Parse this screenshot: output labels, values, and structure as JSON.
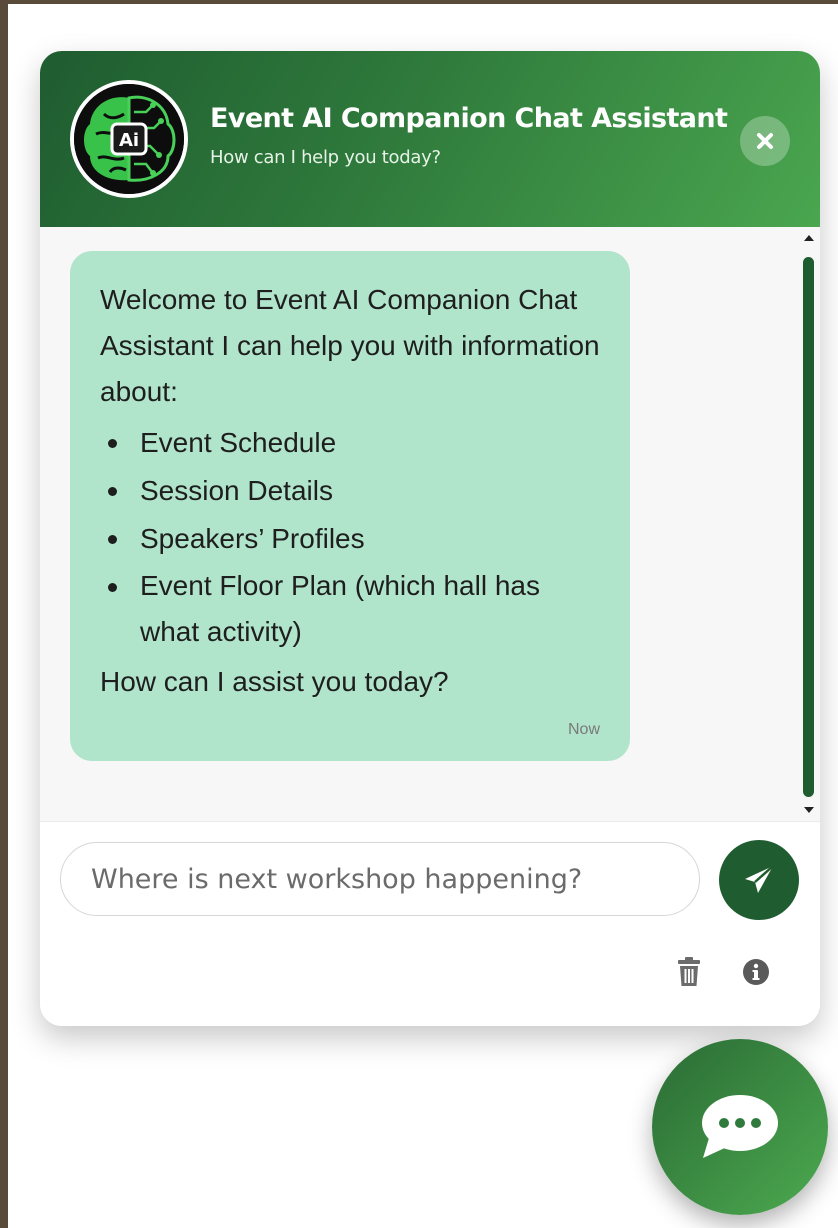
{
  "header": {
    "title": "Event AI Companion Chat Assistant",
    "subtitle": "How can I help you today?",
    "avatar_text": "Ai",
    "avatar_icon": "ai-brain-icon",
    "close_icon": "close-icon"
  },
  "message": {
    "intro": "Welcome to Event AI Companion Chat Assistant I can help you with information about:",
    "items": [
      "Event Schedule",
      "Session Details",
      "Speakers’ Profiles",
      "Event Floor Plan (which hall has what activity)"
    ],
    "outro": "How can I assist you today?",
    "time": "Now"
  },
  "composer": {
    "placeholder": "Where is next workshop happening?",
    "send_icon": "paper-plane-icon",
    "trash_icon": "trash-icon",
    "info_icon": "info-icon"
  },
  "launcher": {
    "icon": "chat-bubble-icon"
  },
  "colors": {
    "header_dark": "#1f5c30",
    "header_light": "#4aa64f",
    "bubble": "#b0e4cb",
    "send_button": "#1f5c30",
    "backdrop": "#5a4a3a"
  }
}
